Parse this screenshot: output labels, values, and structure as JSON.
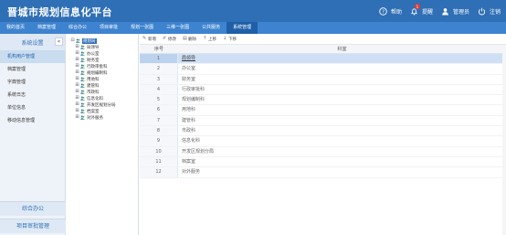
{
  "app": {
    "title": "晋城市规划信息化平台"
  },
  "top_actions": [
    {
      "label": "帮助",
      "icon": "help-icon"
    },
    {
      "label": "提醒",
      "icon": "bell-icon",
      "badge": "1"
    },
    {
      "label": "管理员",
      "icon": "user-icon"
    },
    {
      "label": "注销",
      "icon": "power-icon"
    }
  ],
  "nav": [
    "我的首页",
    "档案管理",
    "综合办公",
    "项目审批",
    "规划一张图",
    "三维一张图",
    "公共服务",
    "系统管理"
  ],
  "nav_active_index": 7,
  "sidebar": {
    "header": "系统设置",
    "collapse_glyph": "«",
    "items": [
      "机构用户管理",
      "档案管理",
      "字典管理",
      "系统日志",
      "单位信息",
      "移动信息管理"
    ],
    "active_index": 0,
    "bottom": [
      "综合办公",
      "项目审批管理"
    ]
  },
  "tree": {
    "root": "规划局",
    "children": [
      "局领导",
      "办公室",
      "财务室",
      "行政审批科",
      "规划编制科",
      "用地科",
      "建管科",
      "市政科",
      "信息化科",
      "开发区规划分局",
      "档案室",
      "对外服务"
    ]
  },
  "toolbar": {
    "add": "新增",
    "edit": "修改",
    "delete": "删除",
    "up": "上移",
    "down": "下移"
  },
  "grid": {
    "columns": {
      "no": "序号",
      "name": "科室"
    },
    "rows": [
      {
        "no": "1",
        "name": "局领导"
      },
      {
        "no": "2",
        "name": "办公室"
      },
      {
        "no": "3",
        "name": "财务室"
      },
      {
        "no": "4",
        "name": "行政审批科"
      },
      {
        "no": "5",
        "name": "规划编制科"
      },
      {
        "no": "6",
        "name": "用地科"
      },
      {
        "no": "7",
        "name": "建管科"
      },
      {
        "no": "8",
        "name": "市政科"
      },
      {
        "no": "9",
        "name": "信息化科"
      },
      {
        "no": "10",
        "name": "开发区规划分局"
      },
      {
        "no": "11",
        "name": "档案室"
      },
      {
        "no": "12",
        "name": "对外服务"
      }
    ],
    "selected_index": 0
  },
  "colors": {
    "header": "#2f6fb6",
    "nav": "#3d83cf",
    "nav_active": "#1f5fa8",
    "selected_row": "#cfe0f6"
  }
}
